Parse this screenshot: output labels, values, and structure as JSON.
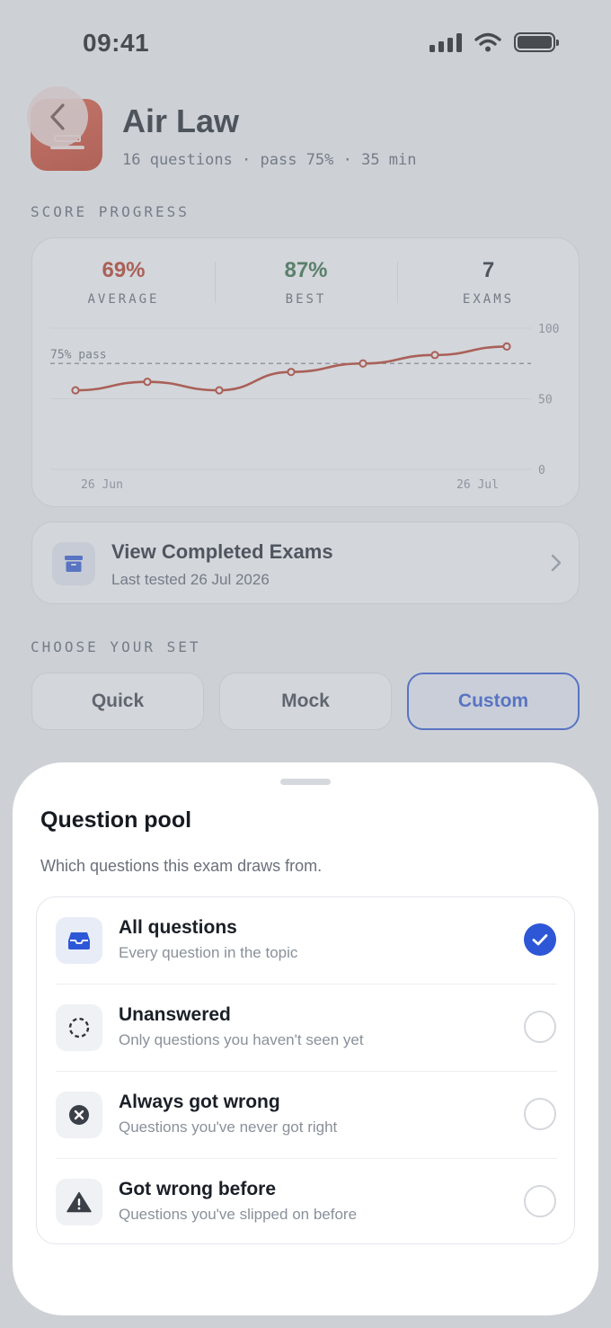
{
  "status_bar": {
    "time": "09:41"
  },
  "header": {
    "title": "Air Law",
    "meta": "16 questions · pass 75% · 35 min"
  },
  "score_progress": {
    "section_label": "SCORE PROGRESS",
    "stats": [
      {
        "value": "69%",
        "label": "AVERAGE",
        "color": "#b8341f"
      },
      {
        "value": "87%",
        "label": "BEST",
        "color": "#2f6b43"
      },
      {
        "value": "7",
        "label": "EXAMS",
        "color": "#1d222b"
      }
    ]
  },
  "chart_data": {
    "type": "line",
    "x_ticks": [
      "26 Jun",
      "26 Jul"
    ],
    "y_ticks": [
      "100",
      "50",
      "0"
    ],
    "ylim": [
      0,
      100
    ],
    "pass_line": {
      "value": 75,
      "label": "75% pass"
    },
    "series": [
      {
        "values": [
          56,
          62,
          56,
          69,
          75,
          81,
          87
        ],
        "color": "#b8341f"
      }
    ],
    "grid": true
  },
  "completed_exams": {
    "title": "View Completed Exams",
    "subtitle": "Last tested 26 Jul 2026"
  },
  "choose_set": {
    "section_label": "CHOOSE YOUR SET",
    "options": [
      "Quick",
      "Mock",
      "Custom"
    ],
    "selected": "Custom"
  },
  "sheet": {
    "title": "Question pool",
    "subtitle": "Which questions this exam draws from.",
    "options": [
      {
        "name": "All questions",
        "description": "Every question in the topic",
        "icon": "inbox-tray-icon",
        "selected": true
      },
      {
        "name": "Unanswered",
        "description": "Only questions you haven't seen yet",
        "icon": "dashed-circle-icon",
        "selected": false
      },
      {
        "name": "Always got wrong",
        "description": "Questions you've never got right",
        "icon": "x-circle-icon",
        "selected": false
      },
      {
        "name": "Got wrong before",
        "description": "Questions you've slipped on before",
        "icon": "warning-triangle-icon",
        "selected": false
      }
    ]
  },
  "colors": {
    "accent": "#2d57d6",
    "chart_line": "#b8341f"
  }
}
